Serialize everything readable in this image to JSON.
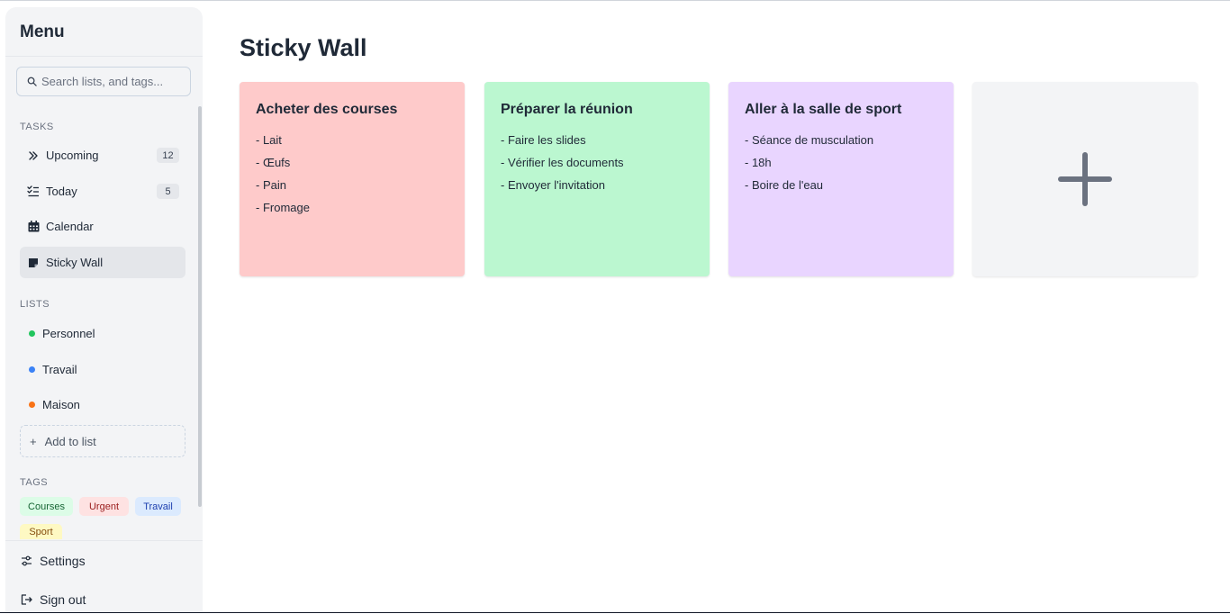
{
  "sidebar": {
    "title": "Menu",
    "search": {
      "placeholder": "Search lists, and tags...",
      "value": ""
    },
    "tasks": {
      "label": "TASKS",
      "items": [
        {
          "label": "Upcoming",
          "icon": "double-chevron-right-icon",
          "count": "12",
          "active": false
        },
        {
          "label": "Today",
          "icon": "checklist-icon",
          "count": "5",
          "active": false
        },
        {
          "label": "Calendar",
          "icon": "calendar-icon",
          "count": "",
          "active": false
        },
        {
          "label": "Sticky Wall",
          "icon": "sticky-note-icon",
          "count": "",
          "active": true
        }
      ]
    },
    "lists": {
      "label": "LISTS",
      "items": [
        {
          "label": "Personnel",
          "color": "#22c55e"
        },
        {
          "label": "Travail",
          "color": "#3b82f6"
        },
        {
          "label": "Maison",
          "color": "#f97316"
        }
      ],
      "add_label": "Add to list"
    },
    "tags": {
      "label": "TAGS",
      "items": [
        {
          "label": "Courses",
          "bg": "#dcfce7",
          "fg": "#166534"
        },
        {
          "label": "Urgent",
          "bg": "#fee2e2",
          "fg": "#991b1b"
        },
        {
          "label": "Travail",
          "bg": "#dbeafe",
          "fg": "#1e40af"
        },
        {
          "label": "Sport",
          "bg": "#fef9c3",
          "fg": "#854d0e"
        }
      ]
    },
    "settings_label": "Settings",
    "signout_label": "Sign out"
  },
  "main": {
    "title": "Sticky Wall",
    "notes": [
      {
        "title": "Acheter des courses",
        "color": "#fecaca",
        "lines": [
          "- Lait",
          "- Œufs",
          "- Pain",
          "- Fromage"
        ]
      },
      {
        "title": "Préparer la réunion",
        "color": "#bbf7d0",
        "lines": [
          "- Faire les slides",
          "- Vérifier les documents",
          "- Envoyer l'invitation"
        ]
      },
      {
        "title": "Aller à la salle de sport",
        "color": "#e9d5ff",
        "lines": [
          "- Séance de musculation",
          "- 18h",
          "- Boire de l'eau"
        ]
      }
    ],
    "add_note_icon": "plus-icon"
  }
}
